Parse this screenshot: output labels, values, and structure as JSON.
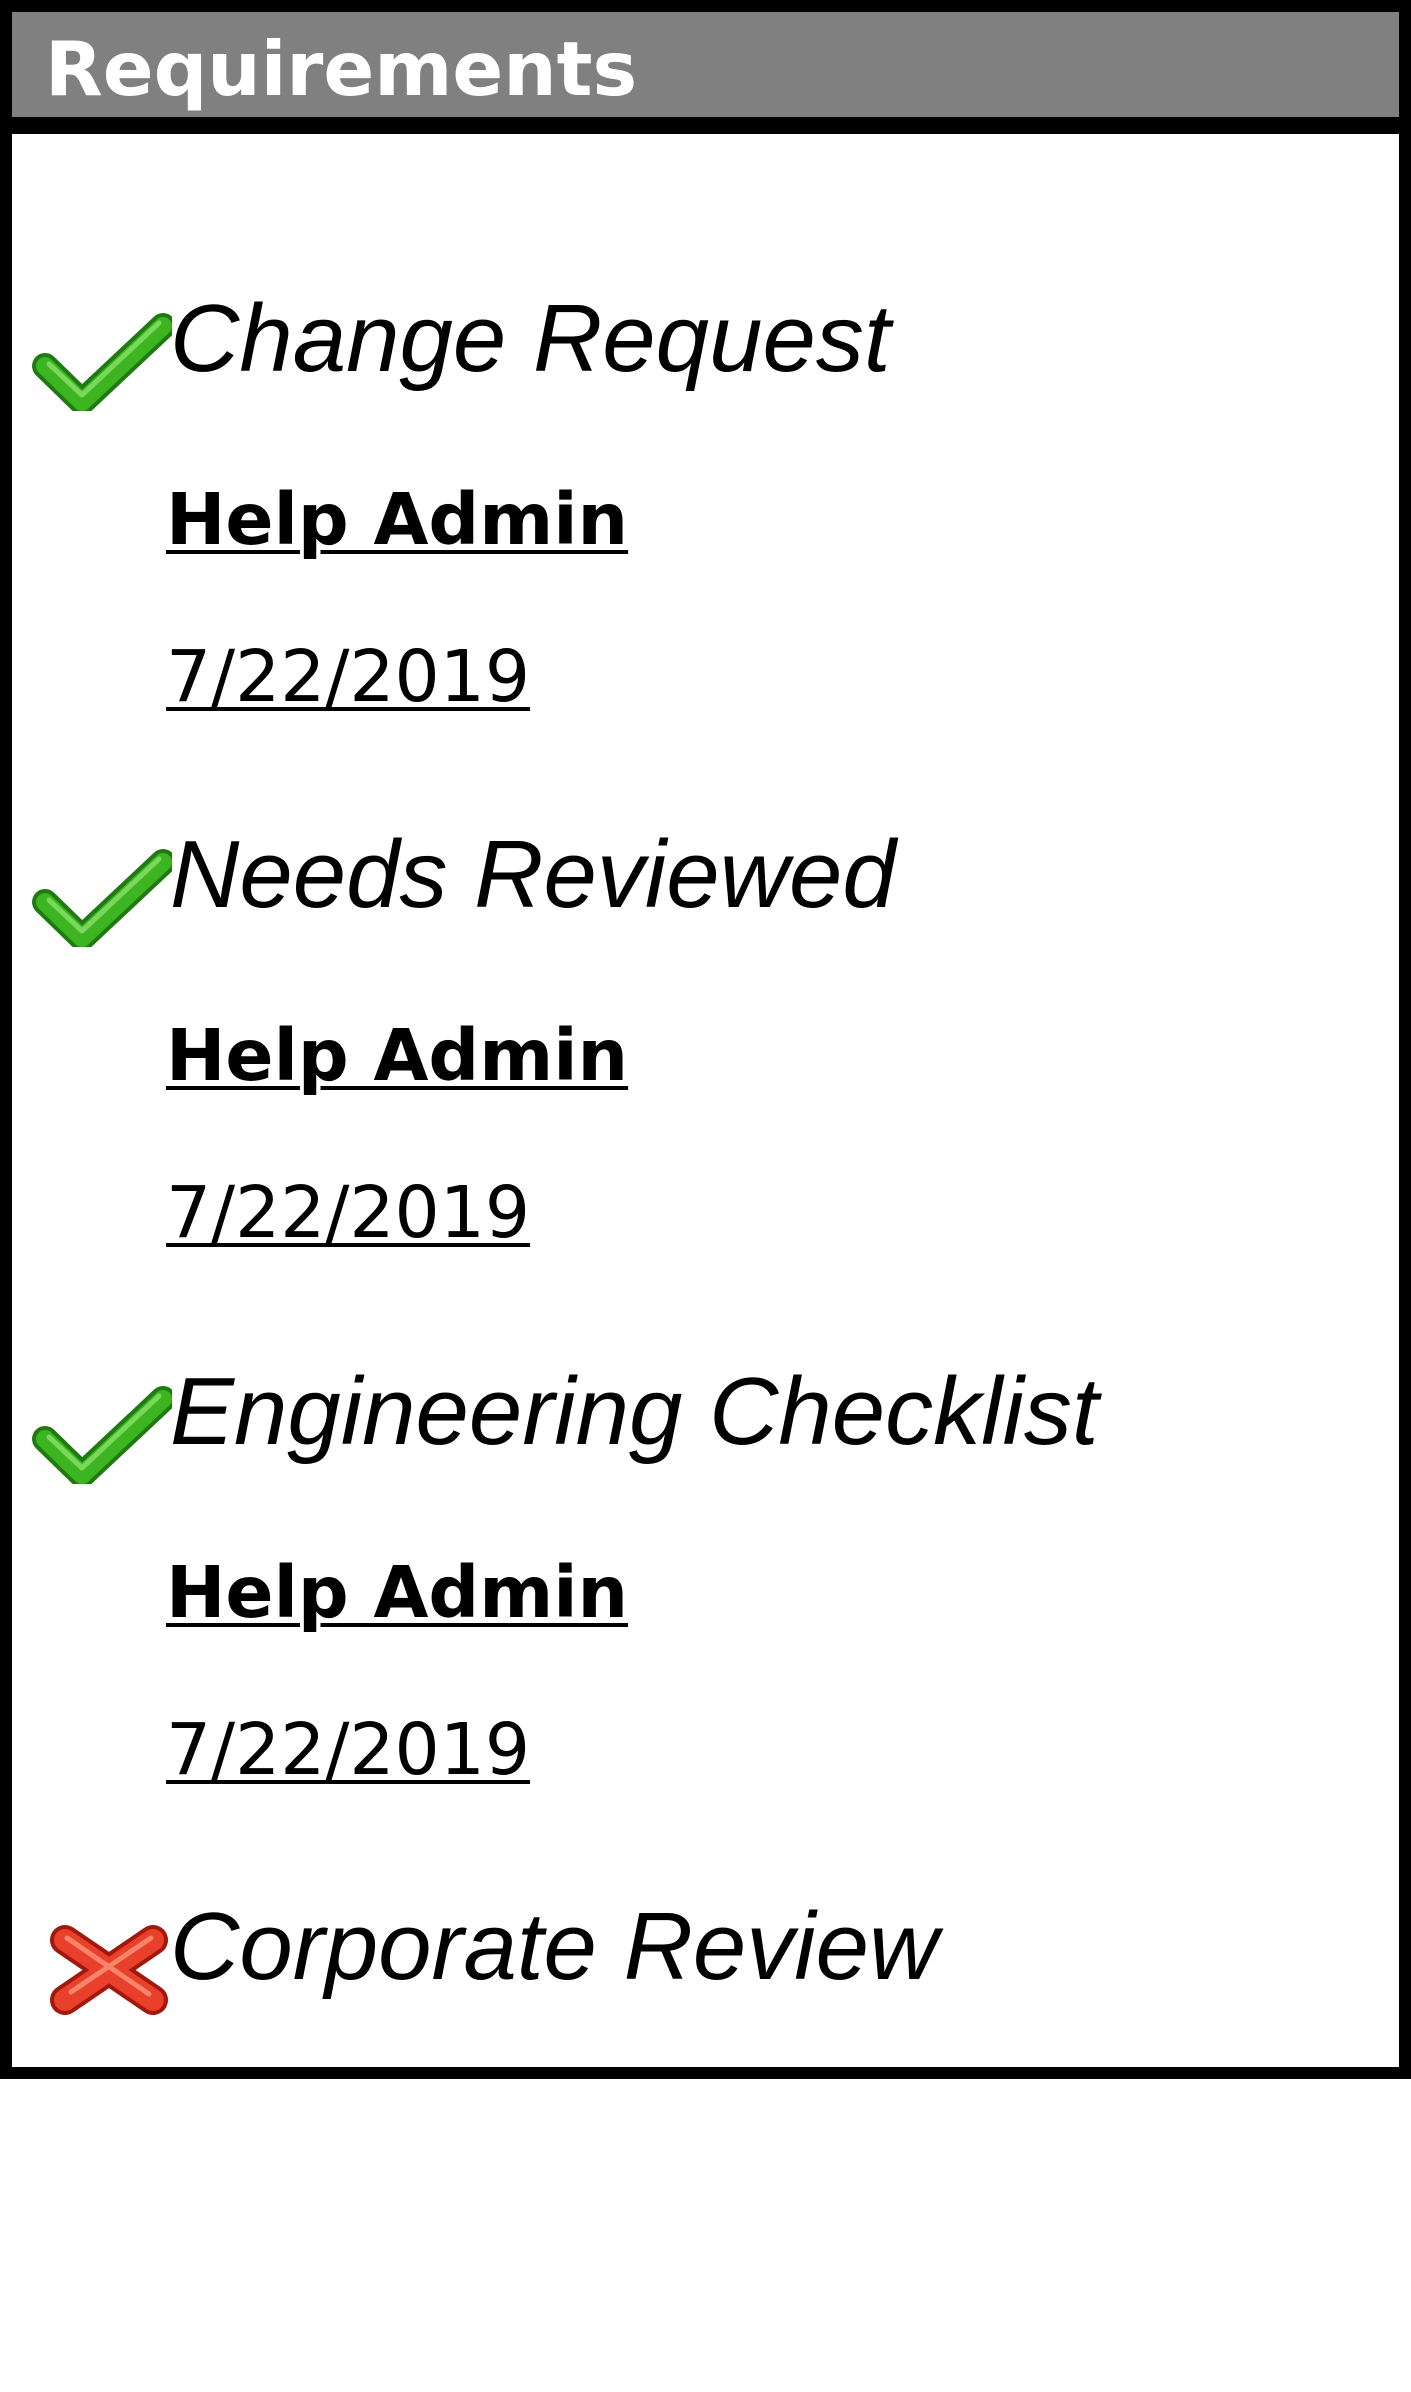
{
  "panel": {
    "title": "Requirements"
  },
  "colors": {
    "header_background": "#808080",
    "header_text": "#ffffff",
    "border": "#000000",
    "check_green": "#3cb521",
    "cross_red": "#e8402a"
  },
  "requirements": [
    {
      "name": "Change Request",
      "status_icon": "check-icon",
      "user": "Help Admin",
      "date": "7/22/2019"
    },
    {
      "name": "Needs Reviewed",
      "status_icon": "check-icon",
      "user": "Help Admin",
      "date": "7/22/2019"
    },
    {
      "name": "Engineering Checklist",
      "status_icon": "check-icon",
      "user": "Help Admin",
      "date": "7/22/2019"
    },
    {
      "name": "Corporate Review",
      "status_icon": "cross-icon"
    }
  ]
}
